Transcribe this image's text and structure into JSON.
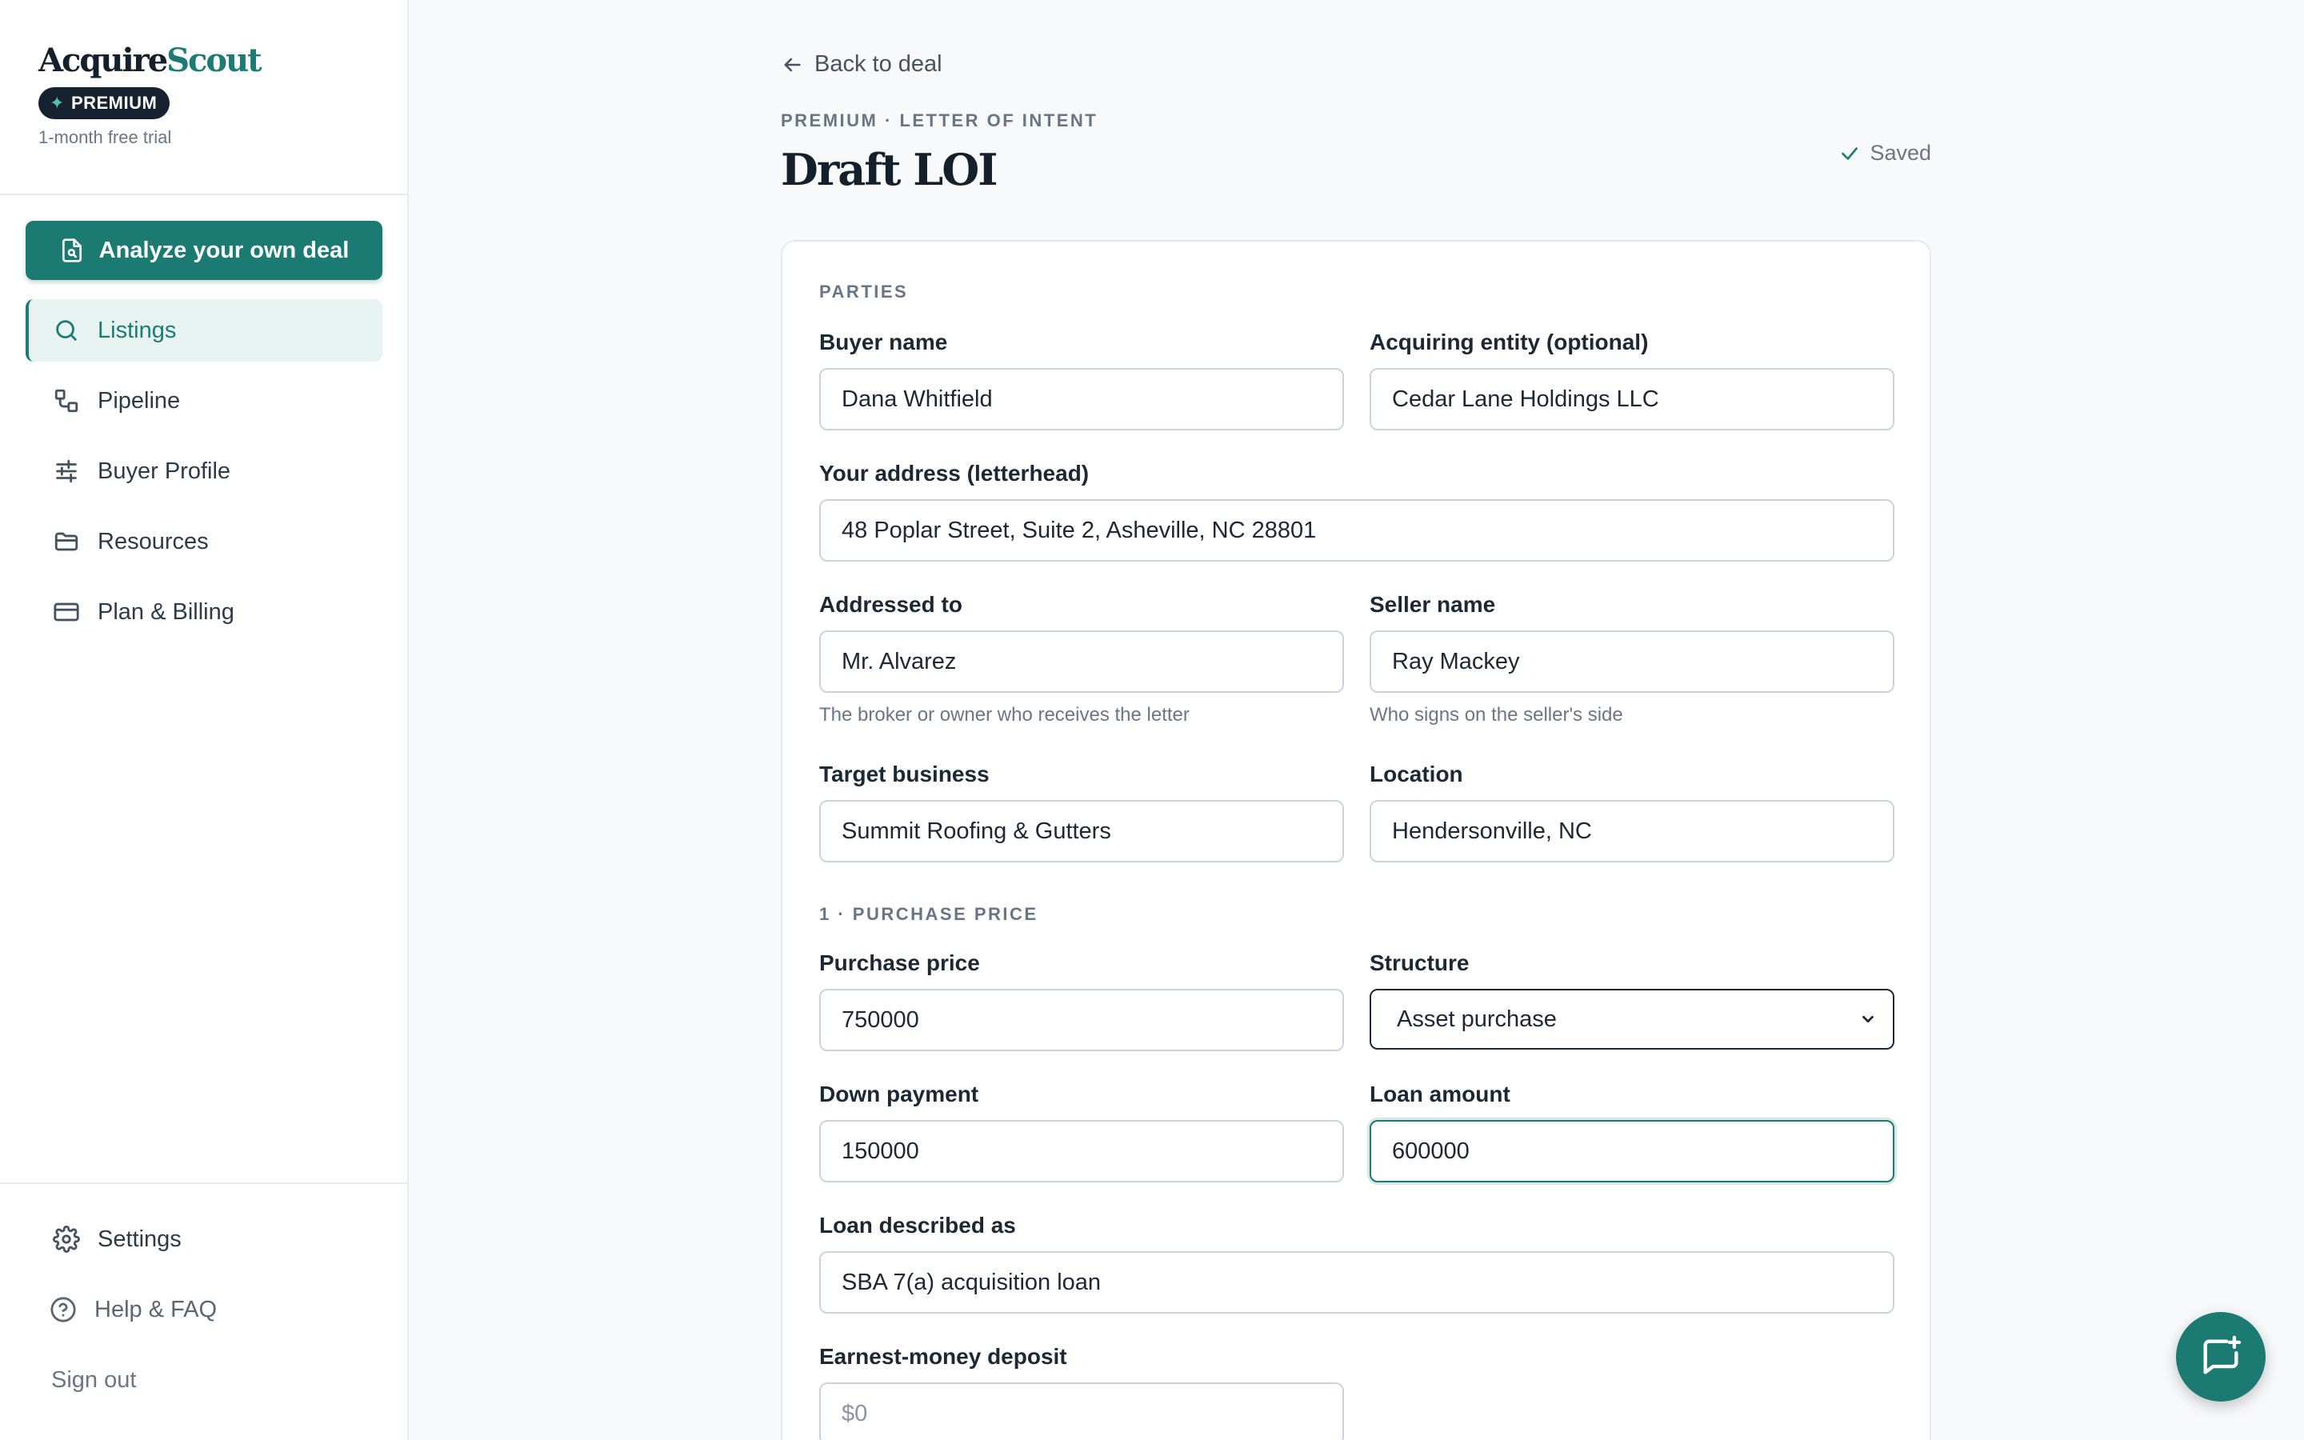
{
  "brand": {
    "logo_part1": "Acquire",
    "logo_part2": "Scout",
    "badge": "PREMIUM",
    "trial": "1-month free trial"
  },
  "sidebar": {
    "analyze_button": "Analyze your own deal",
    "items": [
      {
        "label": "Listings",
        "icon": "search-icon",
        "active": true
      },
      {
        "label": "Pipeline",
        "icon": "pipeline-icon",
        "active": false
      },
      {
        "label": "Buyer Profile",
        "icon": "sliders-icon",
        "active": false
      },
      {
        "label": "Resources",
        "icon": "folder-icon",
        "active": false
      },
      {
        "label": "Plan & Billing",
        "icon": "credit-card-icon",
        "active": false
      }
    ],
    "bottom": {
      "settings": "Settings",
      "help": "Help & FAQ",
      "signout": "Sign out"
    }
  },
  "header": {
    "back": "Back to deal",
    "eyebrow": "PREMIUM · LETTER OF INTENT",
    "title": "Draft LOI",
    "saved": "Saved"
  },
  "form": {
    "parties_section": "PARTIES",
    "buyer_name": {
      "label": "Buyer name",
      "value": "Dana Whitfield"
    },
    "acquiring_entity": {
      "label": "Acquiring entity (optional)",
      "value": "Cedar Lane Holdings LLC"
    },
    "address": {
      "label": "Your address (letterhead)",
      "value": "48 Poplar Street, Suite 2, Asheville, NC 28801"
    },
    "addressed_to": {
      "label": "Addressed to",
      "value": "Mr. Alvarez",
      "hint": "The broker or owner who receives the letter"
    },
    "seller_name": {
      "label": "Seller name",
      "value": "Ray Mackey",
      "hint": "Who signs on the seller's side"
    },
    "target_business": {
      "label": "Target business",
      "value": "Summit Roofing & Gutters"
    },
    "location": {
      "label": "Location",
      "value": "Hendersonville, NC"
    },
    "price_section": "1 · PURCHASE PRICE",
    "purchase_price": {
      "label": "Purchase price",
      "value": "750000"
    },
    "structure": {
      "label": "Structure",
      "value": "Asset purchase"
    },
    "down_payment": {
      "label": "Down payment",
      "value": "150000"
    },
    "loan_amount": {
      "label": "Loan amount",
      "value": "600000"
    },
    "loan_described": {
      "label": "Loan described as",
      "value": "SBA 7(a) acquisition loan"
    },
    "earnest_money": {
      "label": "Earnest-money deposit",
      "value": "",
      "placeholder": "$0"
    }
  },
  "colors": {
    "accent": "#1b7a72",
    "badge_bg": "#162230",
    "background": "#f8f9fb"
  }
}
